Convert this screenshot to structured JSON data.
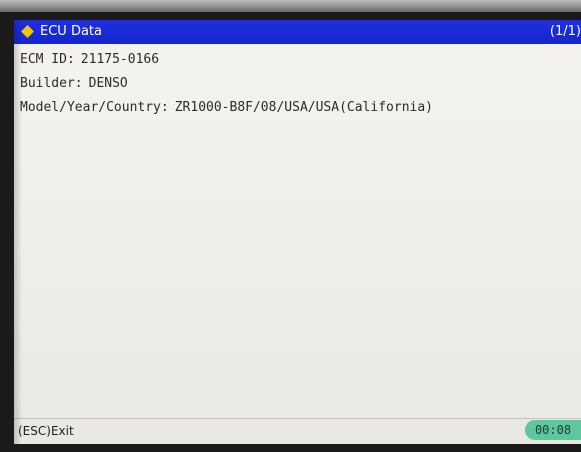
{
  "window": {
    "title": "ECU Data",
    "page_indicator": "(1/1)",
    "title_icon": "yellow-diamond-icon"
  },
  "info": {
    "ecm_id": {
      "label": "ECM ID:",
      "value": "21175-0166"
    },
    "builder": {
      "label": "Builder:",
      "value": "DENSO"
    },
    "model": {
      "label": "Model/Year/Country:",
      "value": "ZR1000-B8F/08/USA/USA(California)"
    }
  },
  "footer": {
    "exit_label": "(ESC)Exit",
    "timer": "00:08"
  },
  "colors": {
    "title_bar": "#1526cf",
    "icon": "#f5c400",
    "timer": "#5fc79f"
  }
}
